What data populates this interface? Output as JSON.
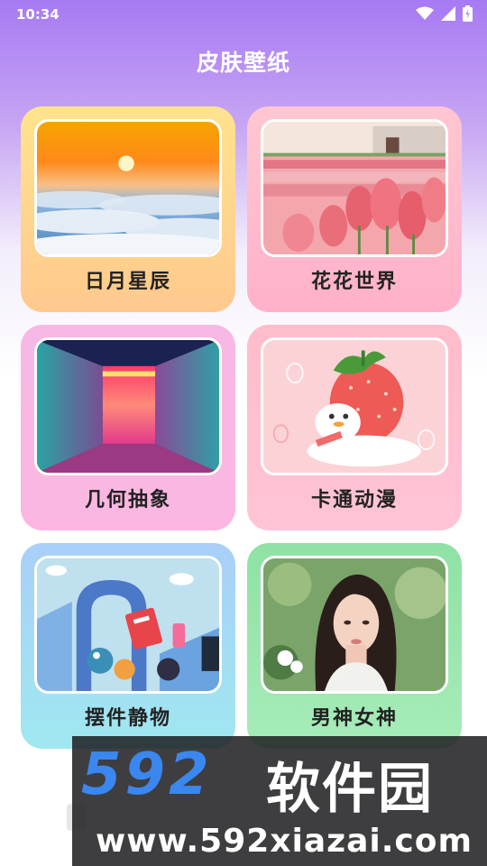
{
  "status_bar": {
    "time": "10:34",
    "icons": [
      "wifi-icon",
      "signal-icon",
      "battery-charging-icon"
    ]
  },
  "header": {
    "title": "皮肤壁纸"
  },
  "categories": [
    {
      "label": "日月星辰",
      "image": "sunrise-over-clouds"
    },
    {
      "label": "花花世界",
      "image": "pink-tulip-field"
    },
    {
      "label": "几何抽象",
      "image": "neon-corridor"
    },
    {
      "label": "卡通动漫",
      "image": "strawberry-duck-cartoon"
    },
    {
      "label": "摆件静物",
      "image": "arch-and-toys-still-life"
    },
    {
      "label": "男神女神",
      "image": "portrait-woman-garden"
    }
  ],
  "watermark": {
    "logo_number": "592",
    "logo_text": "软件园",
    "url": "www.592xiazai.com"
  },
  "colors": {
    "header_gradient_top": "#a779f3",
    "logo_blue": "#3a87f0"
  }
}
